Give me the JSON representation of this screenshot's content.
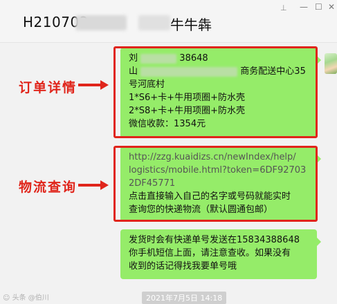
{
  "window": {
    "title_prefix": "H210703",
    "title_suffix": "牛牛犇",
    "pin_glyph": "⊥",
    "minimize_glyph": "—",
    "maximize_glyph": "☐",
    "close_glyph": "✕"
  },
  "annotations": {
    "order_details": "订单详情",
    "logistics_query": "物流查询",
    "color": "#e0251b"
  },
  "messages": {
    "order": {
      "line1_start": "刘",
      "line1_end": "38648",
      "line2_start": "山",
      "line2_end": "商务配送中心35",
      "line3": "号河底村",
      "line4": "1*S6+卡+牛用项圈+防水壳",
      "line5": "2*S8+卡+牛用项圈+防水壳",
      "line6": "微信收款：1354元"
    },
    "logistics": {
      "url_line1": "http://zzg.kuaidizs.cn/newIndex/help/",
      "url_line2": "logistics/mobile.html?token=6DF92703",
      "url_line3": "2DF45771",
      "text_line1": "点击直接输入自己的名字或号码就能实时",
      "text_line2": "查询您的快递物流（默认圆通包邮）"
    },
    "notice": {
      "line1": "发货时会有快递单号发送在15834388648",
      "line2": "你手机短信上面，请注意查收。如果没有",
      "line3": "收到的话记得找我要单号哦"
    }
  },
  "footer": {
    "timestamp": "2021年7月5日 14:18",
    "watermark": "☺ 头条 @伯川"
  },
  "colors": {
    "bubble": "#95ec69",
    "background": "#f2f2f2"
  }
}
